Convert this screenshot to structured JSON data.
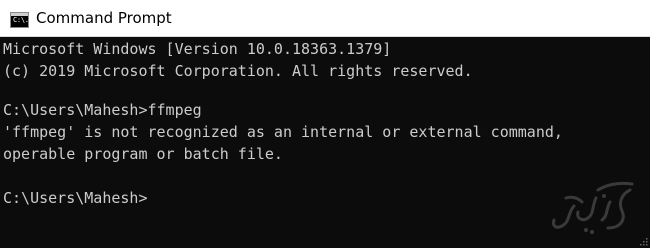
{
  "window": {
    "title": "Command Prompt",
    "icon": "cmd-app-icon",
    "icon_text": "C:\\."
  },
  "console": {
    "lines": [
      "Microsoft Windows [Version 10.0.18363.1379]",
      "(c) 2019 Microsoft Corporation. All rights reserved.",
      "",
      "C:\\Users\\Mahesh>ffmpeg",
      "'ffmpeg' is not recognized as an internal or external command,",
      "operable program or batch file.",
      "",
      "C:\\Users\\Mahesh>"
    ]
  },
  "colors": {
    "console_background": "#0c0c0c",
    "console_text": "#cccccc",
    "titlebar_background": "#ffffff"
  },
  "watermark": {
    "icon": "logo-watermark-icon",
    "text": "آویش"
  }
}
